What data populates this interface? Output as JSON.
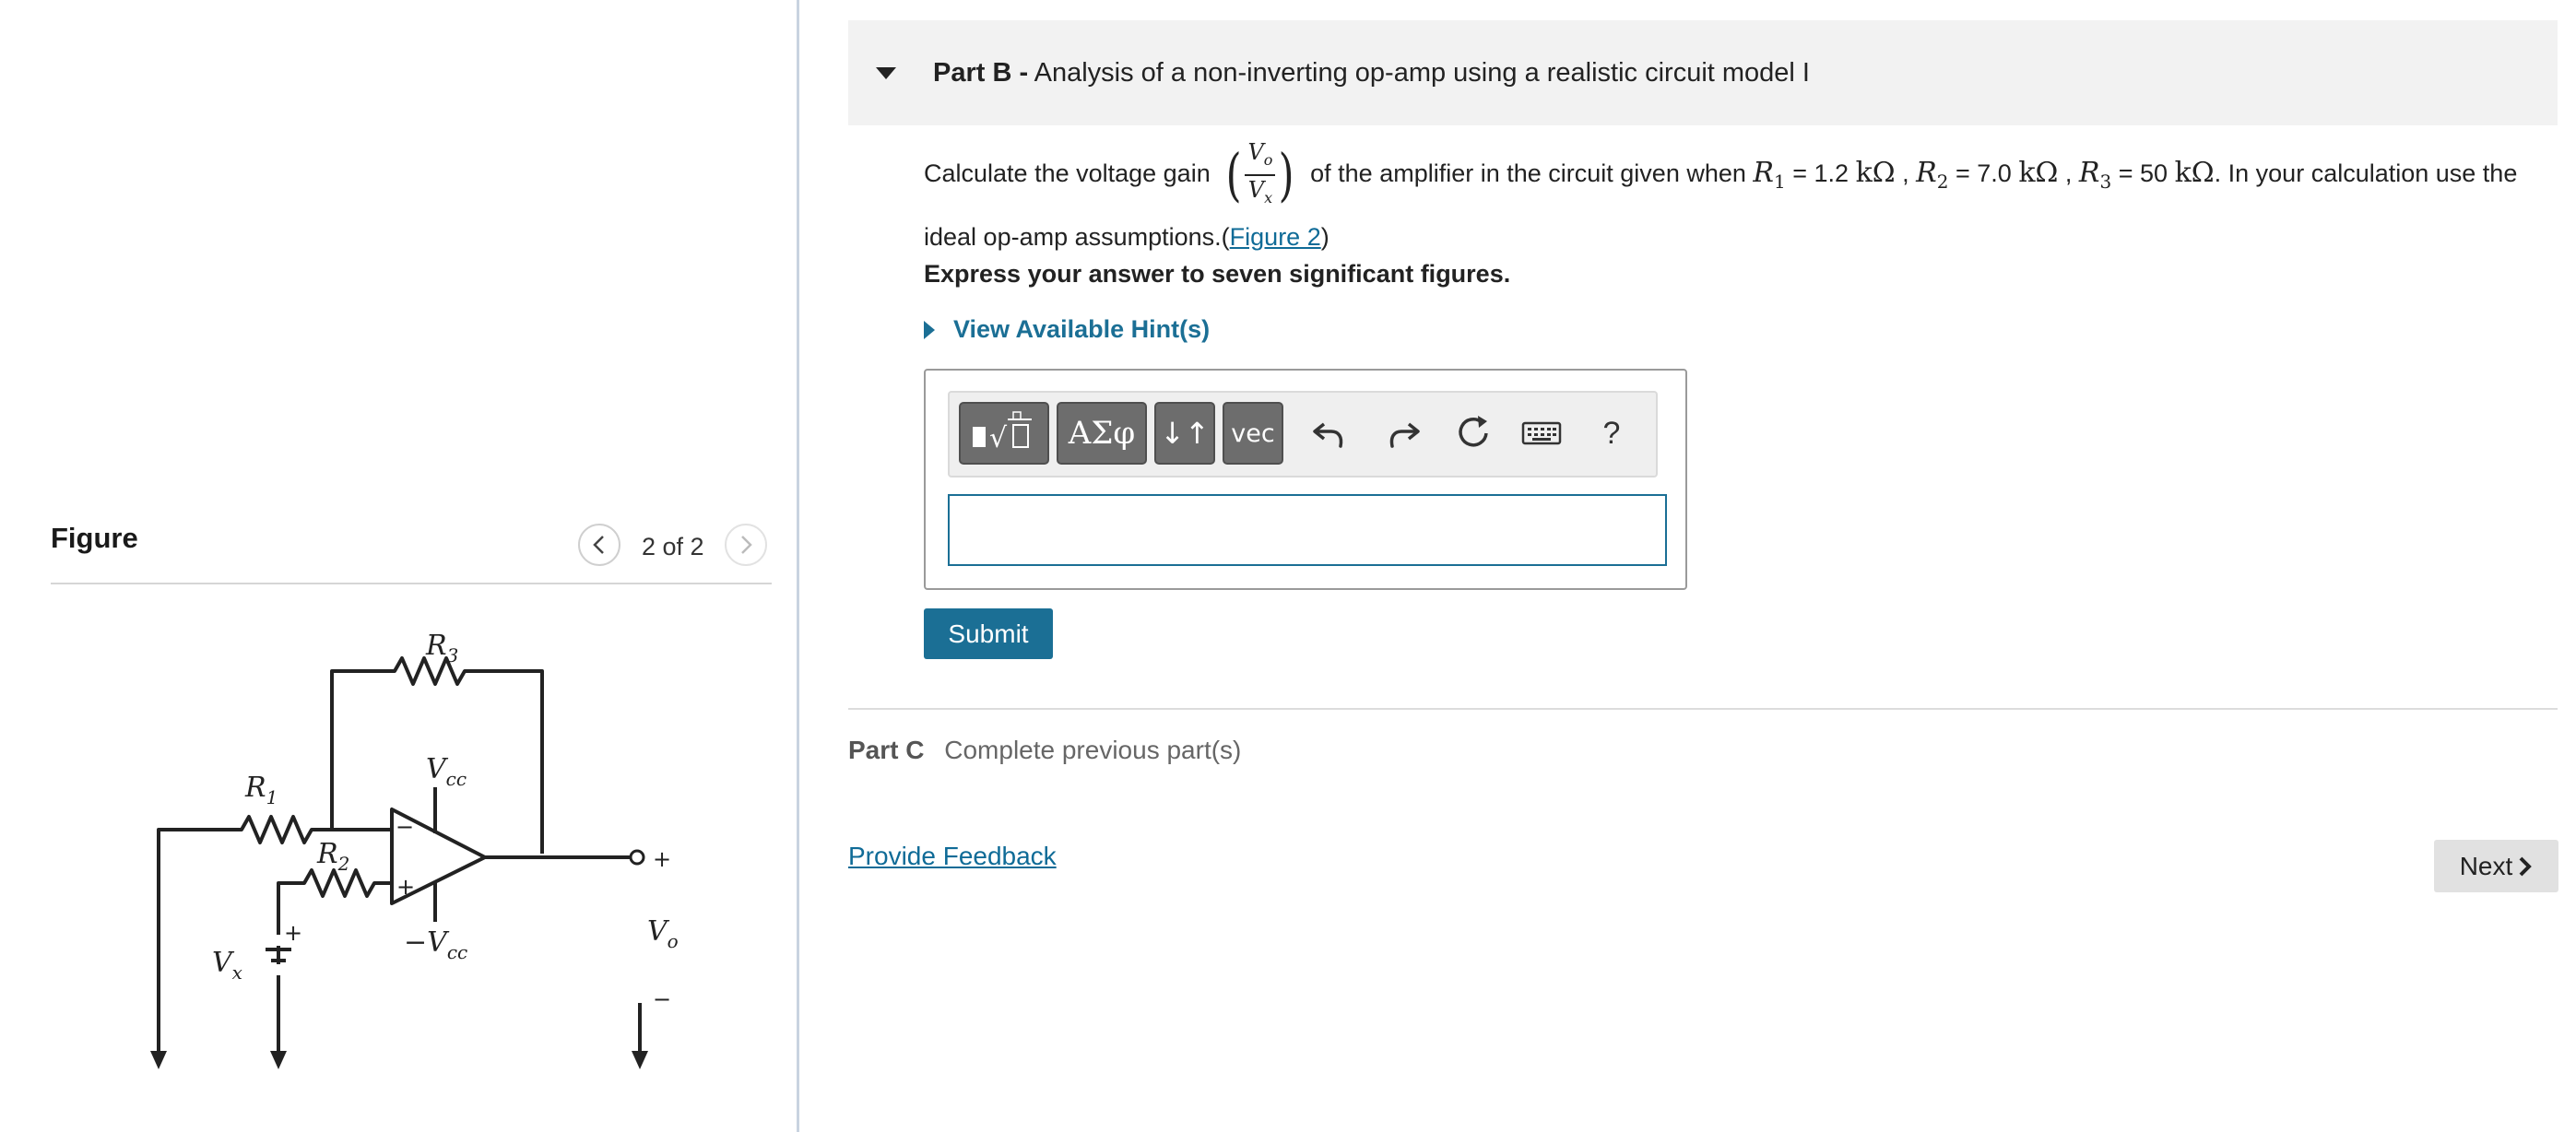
{
  "figure": {
    "title": "Figure",
    "pager": "2 of 2",
    "labels": {
      "r3": "R",
      "r3_sub": "3",
      "r1": "R",
      "r1_sub": "1",
      "r2": "R",
      "r2_sub": "2",
      "vcc": "V",
      "vcc_sub": "cc",
      "neg_vcc": "−V",
      "neg_vcc_sub": "cc",
      "vx": "V",
      "vx_sub": "x",
      "vo": "V",
      "vo_sub": "o",
      "plus": "+",
      "minus": "−"
    }
  },
  "part_b": {
    "label": "Part B -",
    "title": "Analysis of a non-inverting op-amp using a realistic circuit model I",
    "q_prefix": "Calculate the voltage gain",
    "frac_num": "V",
    "frac_num_sub": "o",
    "frac_den": "V",
    "frac_den_sub": "x",
    "q_mid": "of the amplifier in the circuit given when",
    "r1_sym": "R",
    "r1_sub": "1",
    "r1_val": "= 1.2",
    "r2_sym": "R",
    "r2_sub": "2",
    "r2_val": "= 7.0",
    "r3_sym": "R",
    "r3_sub": "3",
    "r3_val": "= 50",
    "unit": "kΩ",
    "q_suffix": ". In your calculation use the ideal op-amp assumptions.(",
    "figure_link": "Figure 2",
    "q_close": ")",
    "express": "Express your answer to seven significant figures.",
    "hints": "View Available Hint(s)",
    "toolbar": {
      "greek": "ΑΣφ",
      "arrows": "↓↑",
      "vec": "vec",
      "help": "?"
    },
    "answer_value": "",
    "submit": "Submit"
  },
  "part_c": {
    "label": "Part C",
    "status": "Complete previous part(s)"
  },
  "feedback": "Provide Feedback",
  "next": "Next"
}
